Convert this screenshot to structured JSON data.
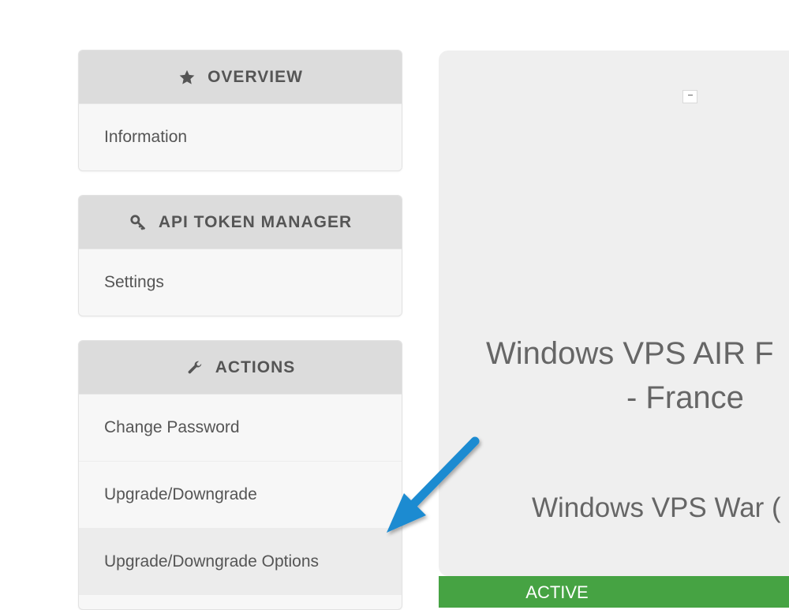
{
  "sidebar": {
    "overview": {
      "title": "OVERVIEW",
      "icon": "star-icon",
      "items": [
        "Information"
      ]
    },
    "api": {
      "title": "API TOKEN MANAGER",
      "icon": "key-icon",
      "items": [
        "Settings"
      ]
    },
    "actions": {
      "title": "ACTIONS",
      "icon": "wrench-icon",
      "items": [
        "Change Password",
        "Upgrade/Downgrade",
        "Upgrade/Downgrade Options"
      ]
    }
  },
  "product": {
    "name_line1": "Windows VPS AIR F",
    "name_line2": "- France",
    "group": "Windows VPS War (",
    "status": "ACTIVE"
  },
  "colors": {
    "status": "#46a343",
    "arrow": "#1e8bd1"
  }
}
